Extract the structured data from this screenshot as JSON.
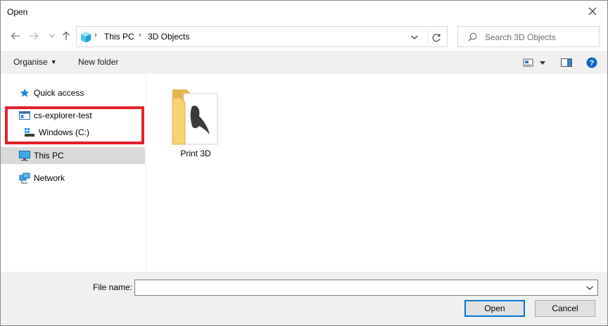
{
  "window": {
    "title": "Open"
  },
  "nav": {
    "breadcrumbs": [
      "This PC",
      "3D Objects"
    ],
    "search_placeholder": "Search 3D Objects",
    "icons": [
      "back-arrow-icon",
      "forward-arrow-icon",
      "recent-chevron-icon",
      "up-arrow-icon",
      "3d-objects-icon",
      "refresh-icon",
      "search-icon"
    ]
  },
  "toolbar": {
    "organise_label": "Organise",
    "new_folder_label": "New folder"
  },
  "sidebar": {
    "items": [
      {
        "label": "Quick access",
        "icon": "star-icon"
      },
      {
        "label": "cs-explorer-test",
        "icon": "window-icon"
      },
      {
        "label": "Windows (C:)",
        "icon": "drive-icon"
      },
      {
        "label": "This PC",
        "icon": "monitor-icon",
        "selected": true
      },
      {
        "label": "Network",
        "icon": "network-icon"
      }
    ]
  },
  "content": {
    "items": [
      {
        "label": "Print 3D",
        "icon": "folder-icon"
      }
    ]
  },
  "bottom": {
    "file_name_label": "File name:",
    "file_name_value": "",
    "open_label": "Open",
    "cancel_label": "Cancel"
  },
  "colors": {
    "accent": "#0078d7",
    "highlight_border": "#e3202a",
    "selection_bg": "#d9d9d9",
    "toolbar_bg": "#f0f0f0"
  }
}
